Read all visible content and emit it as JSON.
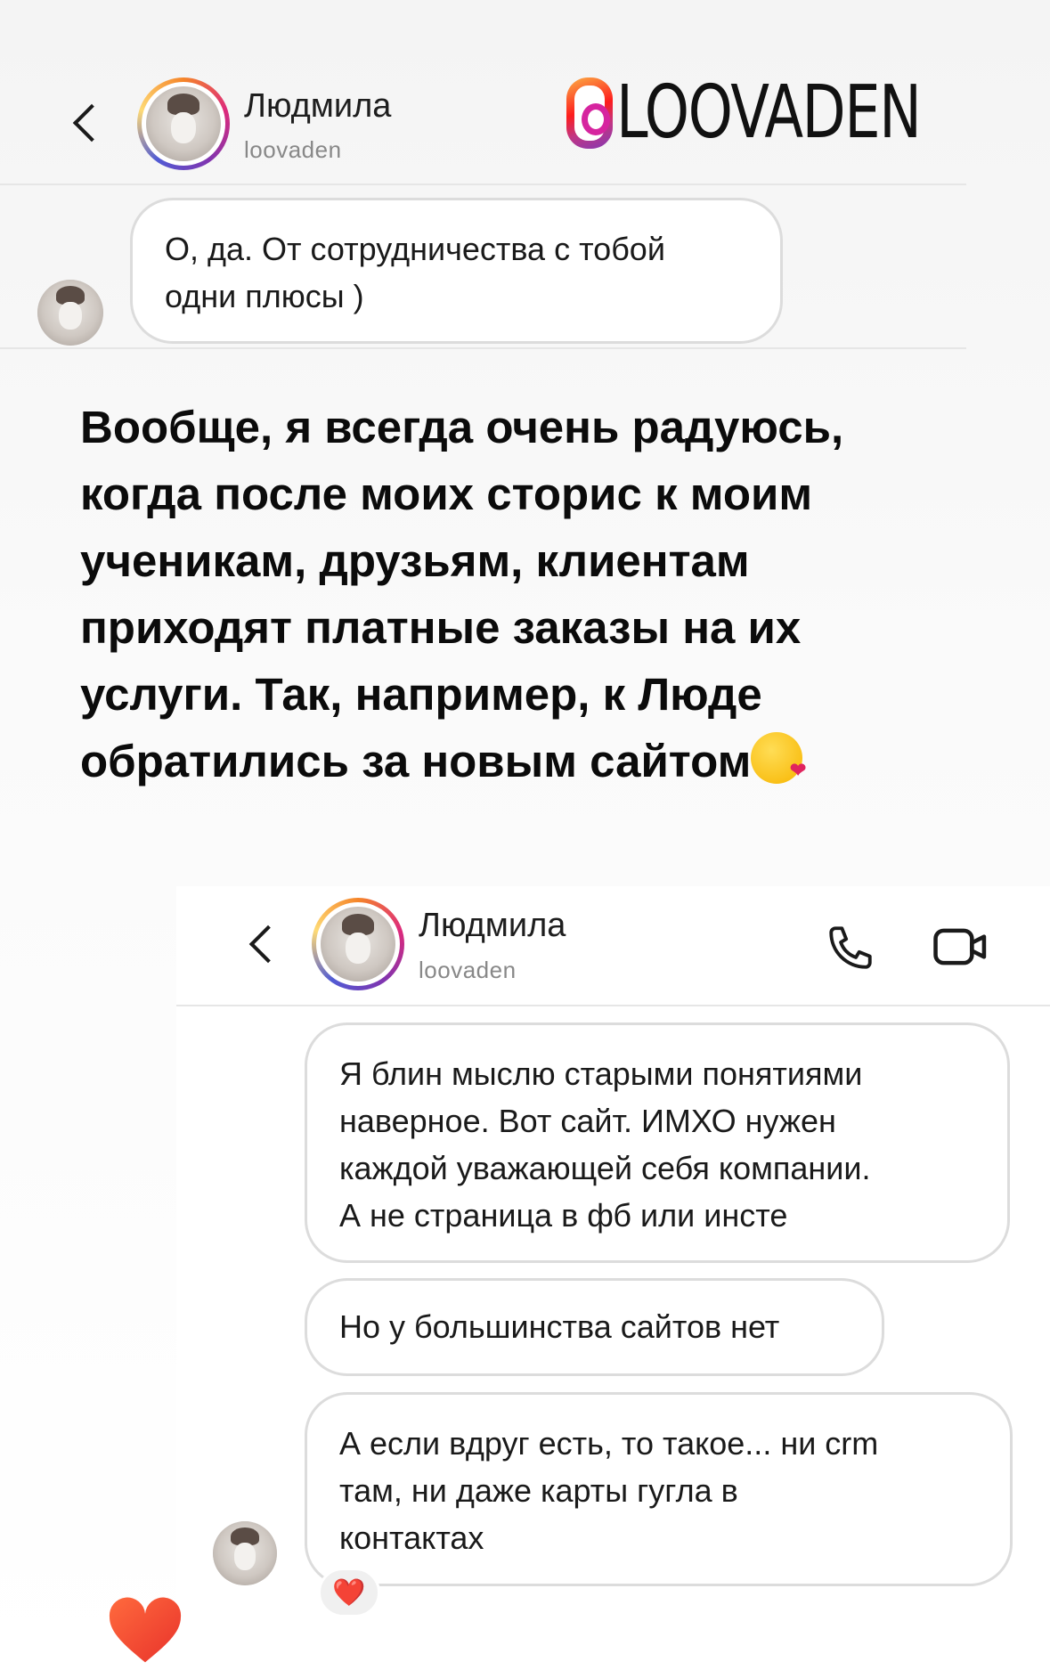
{
  "header_top": {
    "name": "Людмила",
    "username": "loovaden"
  },
  "brand": {
    "text": "LOOVADEN",
    "icon": "threads-icon"
  },
  "chat_top": {
    "message": [
      "О, да. От сотрудничества с тобой",
      "одни плюсы )"
    ]
  },
  "story": {
    "lines": [
      "Вообще, я всегда очень радуюсь,",
      "когда после моих сторис к моим",
      "ученикам, друзьям, клиентам",
      "приходят платные заказы на их",
      "услуги. Так, например, к Люде",
      "обратились за новым сайтом"
    ],
    "emoji": "face-blowing-kiss-emoji"
  },
  "header_bottom": {
    "name": "Людмила",
    "username": "loovaden",
    "icons": [
      "chevron-left-icon",
      "phone-icon",
      "video-icon"
    ]
  },
  "chat_bottom": {
    "message1": [
      "Я блин мыслю старыми понятиями",
      "наверное. Вот сайт. ИМХО нужен",
      "каждой уважающей себя компании.",
      "А не страница в фб или инсте"
    ],
    "message2": "Но у большинства сайтов нет",
    "message3": [
      "А если вдруг есть, то такое... ни crm",
      "там, ни даже карты гугла в",
      "контактах"
    ],
    "reaction": "❤️"
  },
  "colors": {
    "bubble_border": "#dcdcdc",
    "text": "#1a1a1a",
    "muted": "#888888",
    "heart": "#e23c2f"
  }
}
